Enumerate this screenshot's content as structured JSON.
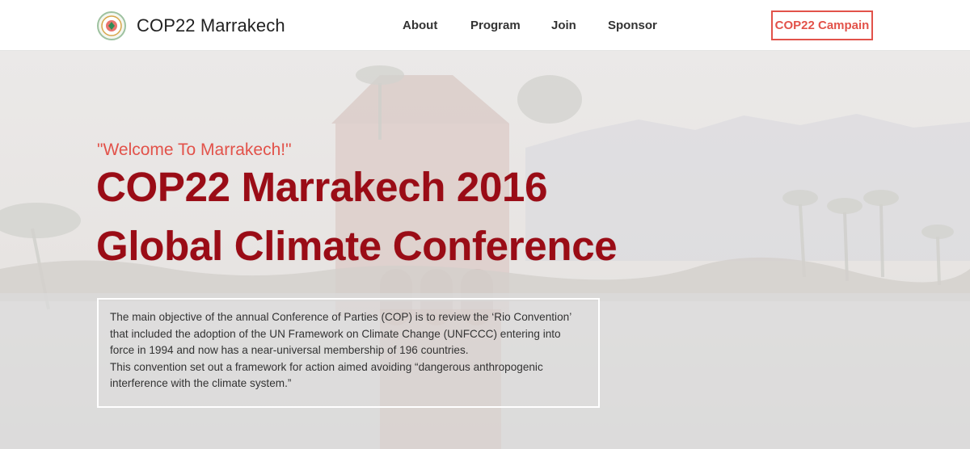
{
  "brand": {
    "name": "COP22 Marrakech",
    "logo_icon": "cop22-emblem-icon"
  },
  "nav": {
    "items": [
      {
        "label": "About"
      },
      {
        "label": "Program"
      },
      {
        "label": "Join"
      },
      {
        "label": "Sponsor"
      }
    ],
    "cta_label": "COP22 Campain"
  },
  "hero": {
    "welcome": "\"Welcome To Marrakech!\"",
    "headline_line1": "COP22 Marrakech 2016",
    "headline_line2": "Global Climate Conference",
    "description_p1": "The main objective of the annual Conference of Parties (COP) is to review the ‘Rio Convention’ that included the adoption of the UN Framework on Climate Change (UNFCCC) entering into force in 1994 and now has a near-universal membership of 196 countries.",
    "description_p2": "This convention set out a framework for action aimed avoiding “dangerous anthropogenic interference with the climate system.”"
  },
  "colors": {
    "accent": "#e2524a",
    "headline": "#9a0c16",
    "nav_text": "#333333"
  }
}
